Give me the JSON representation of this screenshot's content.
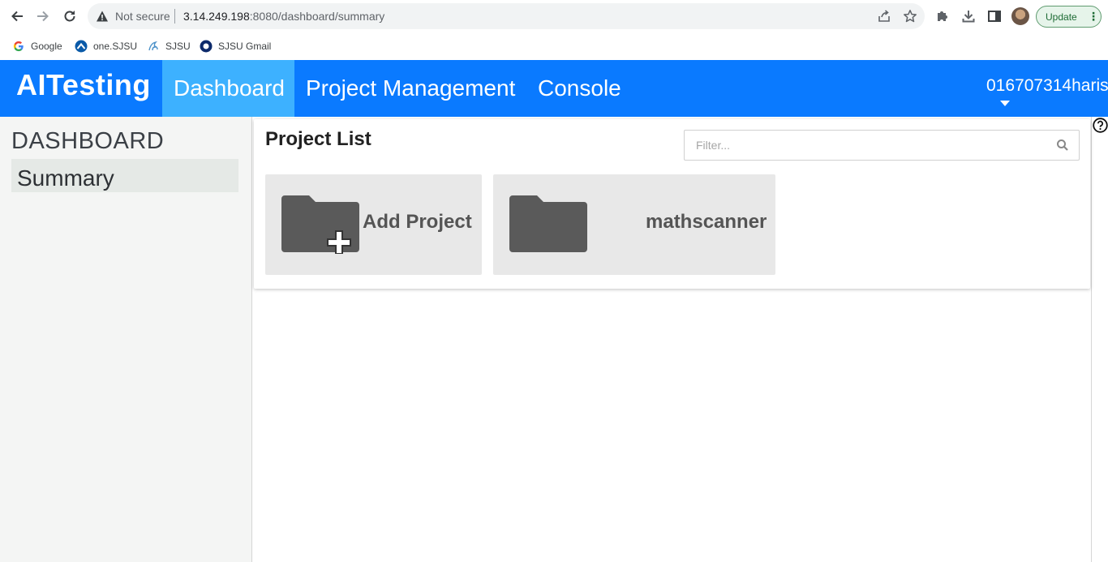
{
  "browser": {
    "not_secure_label": "Not secure",
    "url_host": "3.14.249.198",
    "url_rest": ":8080/dashboard/summary",
    "update_label": "Update",
    "bookmarks": [
      {
        "label": "Google",
        "icon": "google-icon"
      },
      {
        "label": "one.SJSU",
        "icon": "one-sjsu-icon"
      },
      {
        "label": "SJSU",
        "icon": "sjsu-icon"
      },
      {
        "label": "SJSU Gmail",
        "icon": "sjsu-gmail-icon"
      }
    ]
  },
  "header": {
    "brand": "AITesting",
    "nav": [
      {
        "label": "Dashboard",
        "active": true
      },
      {
        "label": "Project Management",
        "active": false
      },
      {
        "label": "Console",
        "active": false
      }
    ],
    "user": "016707314harish"
  },
  "sidebar": {
    "title": "DASHBOARD",
    "items": [
      {
        "label": "Summary",
        "selected": true
      }
    ]
  },
  "project_list": {
    "title": "Project List",
    "filter_placeholder": "Filter...",
    "filter_value": "",
    "cards": [
      {
        "label": "Add Project",
        "icon": "folder-add-icon"
      },
      {
        "label": "mathscanner",
        "icon": "folder-icon"
      }
    ]
  },
  "colors": {
    "header_bg": "#0a7aff",
    "nav_active_bg": "#3db1ff",
    "sidebar_bg": "#f4f5f4",
    "card_bg": "#e8e8e8",
    "folder": "#5a5a5a"
  }
}
